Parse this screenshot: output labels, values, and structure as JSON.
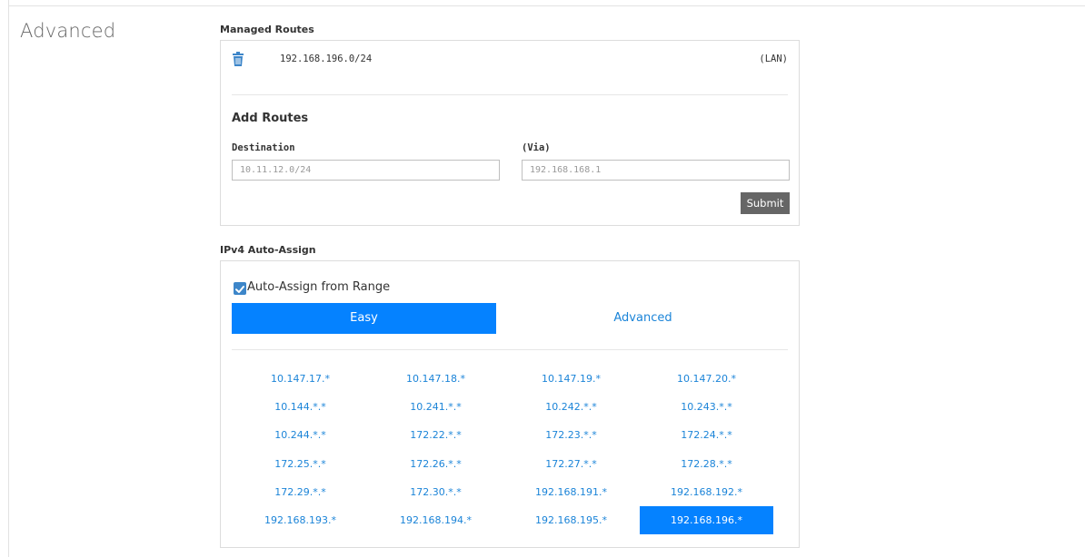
{
  "section": {
    "title": "Advanced"
  },
  "managed_routes": {
    "label": "Managed Routes",
    "routes": [
      {
        "ip": "192.168.196.0/24",
        "tag": "(LAN)"
      }
    ]
  },
  "add_routes": {
    "title": "Add Routes",
    "destination_label": "Destination",
    "destination_placeholder": "10.11.12.0/24",
    "via_label": "(Via)",
    "via_placeholder": "192.168.168.1",
    "submit_label": "Submit"
  },
  "ipv4": {
    "label": "IPv4 Auto-Assign",
    "checkbox_label": "Auto-Assign from Range",
    "checkbox_checked": true,
    "tabs": [
      {
        "label": "Easy",
        "active": true
      },
      {
        "label": "Advanced",
        "active": false
      }
    ],
    "ranges": [
      [
        "10.147.17.*",
        "10.147.18.*",
        "10.147.19.*",
        "10.147.20.*"
      ],
      [
        "10.144.*.*",
        "10.241.*.*",
        "10.242.*.*",
        "10.243.*.*"
      ],
      [
        "10.244.*.*",
        "172.22.*.*",
        "172.23.*.*",
        "172.24.*.*"
      ],
      [
        "172.25.*.*",
        "172.26.*.*",
        "172.27.*.*",
        "172.28.*.*"
      ],
      [
        "172.29.*.*",
        "172.30.*.*",
        "192.168.191.*",
        "192.168.192.*"
      ],
      [
        "192.168.193.*",
        "192.168.194.*",
        "192.168.195.*",
        "192.168.196.*"
      ]
    ],
    "selected_range": "192.168.196.*"
  },
  "colors": {
    "accent": "#0582ff",
    "link": "#1b84d8",
    "icon": "#3d86c9",
    "submit_bg": "#666666"
  }
}
